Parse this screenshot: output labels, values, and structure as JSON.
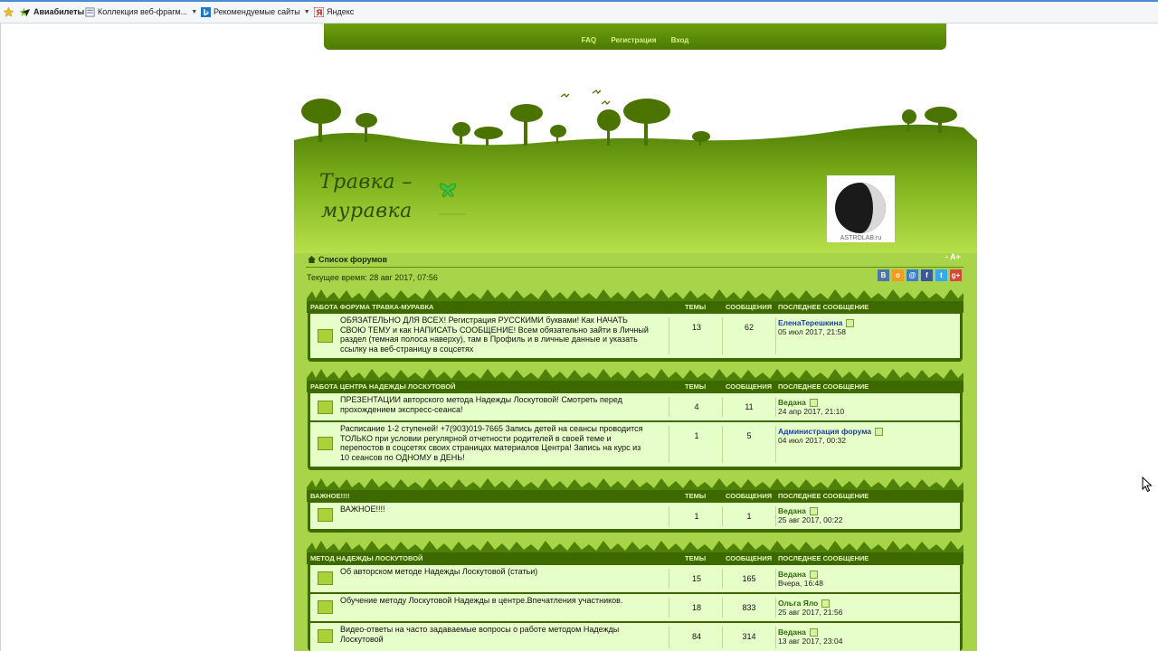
{
  "browser": {
    "favorites": [
      {
        "label": "Авиабилеты",
        "has_menu": false
      },
      {
        "label": "Коллекция веб-фрагм...",
        "has_menu": true
      },
      {
        "label": "Рекомендуемые сайты",
        "has_menu": true
      },
      {
        "label": "Яндекс",
        "has_menu": false
      }
    ]
  },
  "nav": {
    "faq": "FAQ",
    "register": "Регистрация",
    "login": "Вход"
  },
  "site": {
    "title_line1": "Травка –",
    "title_line2": "муравка",
    "moon_label": "ASTROLAB.ru"
  },
  "breadcrumb": {
    "label": "Список форумов"
  },
  "font_size_ctrl": "- A+",
  "current_time": "Текущее время: 28 авг 2017, 07:56",
  "social": [
    "В",
    "о",
    "@",
    "f",
    "t",
    "g+"
  ],
  "columns": {
    "topics": "ТЕМЫ",
    "posts": "СООБЩЕНИЯ",
    "last": "ПОСЛЕДНЕЕ СООБЩЕНИЕ"
  },
  "categories": [
    {
      "name": "РАБОТА ФОРУМА ТРАВКА-МУРАВКА",
      "forums": [
        {
          "title": "ОБЯЗАТЕЛЬНО ДЛЯ ВСЕХ! Регистрация РУССКИМИ буквами! Как НАЧАТЬ СВОЮ ТЕМУ и как НАПИСАТЬ СООБЩЕНИЕ! Всем обязательно зайти в Личный раздел (темная полоса наверху), там в Профиль и в личные данные и указать ссылку на веб-страницу в соцсетях",
          "topics": "13",
          "posts": "62",
          "last_user": "ЕленаТерешкина",
          "last_date": "05 июл 2017, 21:58"
        }
      ]
    },
    {
      "name": "РАБОТА ЦЕНТРА НАДЕЖДЫ ЛОСКУТОВОЙ",
      "forums": [
        {
          "title": "ПРЕЗЕНТАЦИИ авторского метода Надежды Лоскутовой! Смотреть перед прохождением экспресс-сеанса!",
          "topics": "4",
          "posts": "11",
          "last_user": "Ведана",
          "last_date": "24 апр 2017, 21:10"
        },
        {
          "title": "Расписание 1-2 ступеней! +7(903)019-7665 Запись детей на сеансы проводится ТОЛЬКО при условии регулярной отчетности родителей в своей теме и перепостов в соцсетях своих страницах материалов Центра! Запись на курс из 10 сеансов по ОДНОМУ в ДЕНЬ!",
          "topics": "1",
          "posts": "5",
          "last_user": "Администрация форума",
          "last_date": "04 июл 2017, 00:32"
        }
      ]
    },
    {
      "name": "ВАЖНОЕ!!!!",
      "forums": [
        {
          "title": "ВАЖНОЕ!!!!",
          "topics": "1",
          "posts": "1",
          "last_user": "Ведана",
          "last_date": "25 авг 2017, 00:22"
        }
      ]
    },
    {
      "name": "МЕТОД НАДЕЖДЫ ЛОСКУТОВОЙ",
      "forums": [
        {
          "title": "Об авторском методе Надежды Лоскутовой (статьи)",
          "topics": "15",
          "posts": "165",
          "last_user": "Ведана",
          "last_date": "Вчера, 16:48"
        },
        {
          "title": "Обучение методу Лоскутовой Надежды в центре.Впечатления участников.",
          "topics": "18",
          "posts": "833",
          "last_user": "Ольга Яло",
          "last_date": "25 авг 2017, 21:56"
        },
        {
          "title": "Видео-ответы на часто задаваемые вопросы о работе методом Надежды Лоскутовой",
          "topics": "84",
          "posts": "314",
          "last_user": "Ведана",
          "last_date": "13 авг 2017, 23:04"
        }
      ]
    }
  ],
  "colors": {
    "dark_green": "#3d6a00",
    "panel": "#a8d44a",
    "row_bg": "#e6ffc8",
    "user_blue": "#1a3ea8",
    "user_green": "#2f6a0a"
  }
}
